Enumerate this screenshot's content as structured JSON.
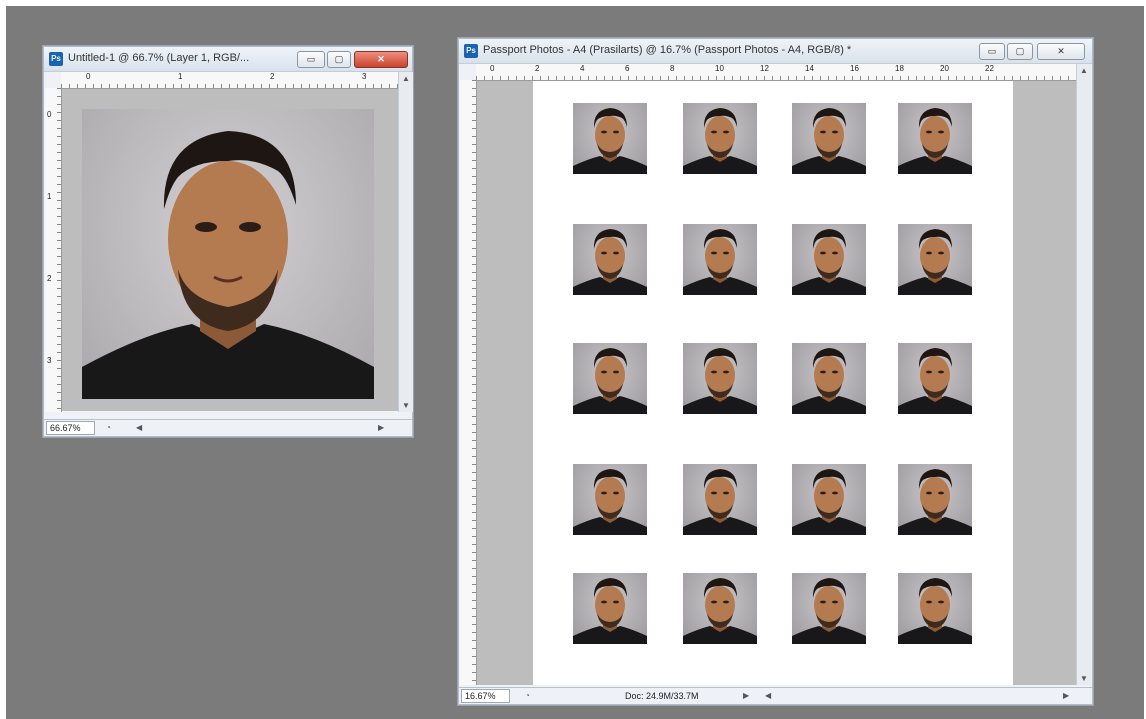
{
  "windows": {
    "source": {
      "title": "Untitled-1 @ 66.7% (Layer 1, RGB/...",
      "badge": "Ps",
      "zoom": "66.67%",
      "ruler_h_ticks": [
        "0",
        "1",
        "2",
        "3"
      ],
      "ruler_v_ticks": [
        "0",
        "1",
        "2",
        "3"
      ]
    },
    "sheet": {
      "title": "Passport Photos - A4 (Prasilarts) @ 16.7% (Passport Photos - A4, RGB/8) *",
      "badge": "Ps",
      "zoom": "16.67%",
      "doc_info": "Doc: 24.9M/33.7M",
      "ruler_h_ticks": [
        "0",
        "2",
        "4",
        "6",
        "8",
        "10",
        "12",
        "14",
        "16",
        "18",
        "20",
        "22"
      ],
      "grid": {
        "rows": 5,
        "cols": 4
      }
    }
  },
  "icons": {
    "minimize": "minimize-icon",
    "restore": "restore-icon",
    "close": "close-icon"
  },
  "colors": {
    "workspace": "#7b7b7b",
    "canvas_bg": "#bdbdbd",
    "close_red": "#c9432d",
    "ps_blue": "#1b63b0"
  }
}
